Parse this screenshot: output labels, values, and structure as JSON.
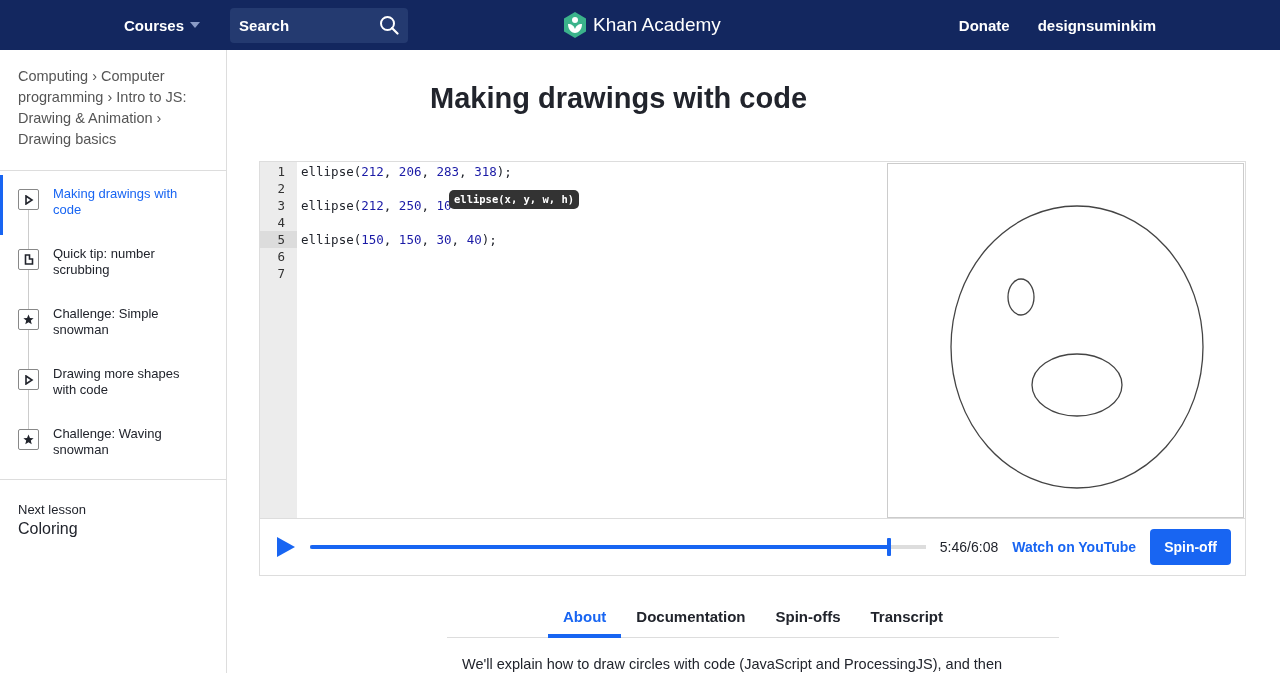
{
  "header": {
    "courses": "Courses",
    "search": {
      "placeholder": "Search"
    },
    "logo": "Khan Academy",
    "donate": "Donate",
    "user": "designsuminkim"
  },
  "sidebar": {
    "breadcrumbs": "Computing › Computer programming › Intro to JS: Drawing & Animation › Drawing basics",
    "items": [
      {
        "kind": "video",
        "label": "Making drawings with code",
        "selected": true
      },
      {
        "kind": "article",
        "label": "Quick tip: number scrubbing",
        "selected": false
      },
      {
        "kind": "challenge",
        "label": "Challenge: Simple snowman",
        "selected": false
      },
      {
        "kind": "video",
        "label": "Drawing more shapes with code",
        "selected": false
      },
      {
        "kind": "challenge",
        "label": "Challenge: Waving snowman",
        "selected": false
      }
    ],
    "next_label": "Next lesson",
    "next_title": "Coloring"
  },
  "title": "Making drawings with code",
  "editor": {
    "lines": [
      {
        "number": "1",
        "code": "ellipse(212, 206, 283, 318);",
        "selected": false
      },
      {
        "number": "2",
        "selected": false
      },
      {
        "number": "3",
        "code": "ellipse(212, 250, 10",
        "selected": false
      },
      {
        "number": "4",
        "selected": false
      },
      {
        "number": "5",
        "code": "ellipse(150, 150, 30, 40);",
        "selected": true
      },
      {
        "number": "6",
        "selected": false
      },
      {
        "number": "7",
        "selected": false
      }
    ],
    "tooltip": "ellipse(x, y, w, h)"
  },
  "player": {
    "level": 0.94,
    "time": "5:46/6:08",
    "youtube": "Watch on YouTube",
    "spinoff": "Spin-off"
  },
  "tabs": [
    {
      "label": "About",
      "selected": true
    },
    {
      "label": "Documentation",
      "selected": false
    },
    {
      "label": "Spin-offs",
      "selected": false
    },
    {
      "label": "Transcript",
      "selected": false
    }
  ],
  "description": "We'll explain how to draw circles with code (JavaScript and ProcessingJS), and then"
}
